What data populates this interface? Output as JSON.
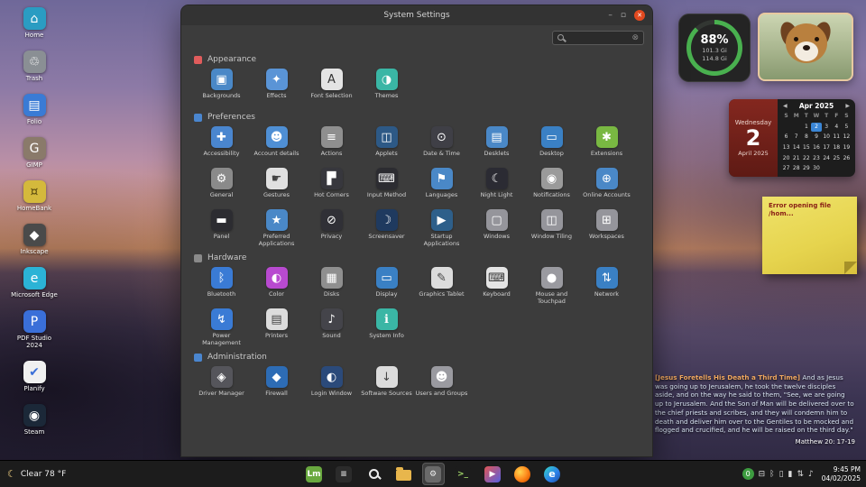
{
  "window": {
    "title": "System Settings",
    "controls": {
      "minimize": "–",
      "maximize": "▫",
      "close": "✕"
    },
    "search": {
      "value": "",
      "placeholder": "",
      "clear_glyph": "⊗"
    },
    "sections": [
      {
        "name": "Appearance",
        "color": "#e05c5c",
        "items": [
          {
            "label": "Backgrounds",
            "bg": "#4a88c7",
            "glyph": "▣"
          },
          {
            "label": "Effects",
            "bg": "#5a94d6",
            "glyph": "✦"
          },
          {
            "label": "Font Selection",
            "bg": "#e4e4e4",
            "fg": "#333333",
            "glyph": "A"
          },
          {
            "label": "Themes",
            "bg": "#3ab6a5",
            "glyph": "◑"
          }
        ]
      },
      {
        "name": "Preferences",
        "color": "#4a86cf",
        "items": [
          {
            "label": "Accessibility",
            "bg": "#4a86cf",
            "glyph": "✚"
          },
          {
            "label": "Account details",
            "bg": "#4f8fd4",
            "glyph": "☻"
          },
          {
            "label": "Actions",
            "bg": "#8f8f8f",
            "glyph": "≡"
          },
          {
            "label": "Applets",
            "bg": "#2d5986",
            "glyph": "◫"
          },
          {
            "label": "Date & Time",
            "bg": "#3f3f46",
            "glyph": "⊙"
          },
          {
            "label": "Desklets",
            "bg": "#4a88c7",
            "glyph": "▤"
          },
          {
            "label": "Desktop",
            "bg": "#3a80c4",
            "glyph": "▭"
          },
          {
            "label": "Extensions",
            "bg": "#79b842",
            "glyph": "✱"
          },
          {
            "label": "General",
            "bg": "#8a8a8a",
            "glyph": "⚙"
          },
          {
            "label": "Gestures",
            "bg": "#e0e0e0",
            "fg": "#444444",
            "glyph": "☛"
          },
          {
            "label": "Hot Corners",
            "bg": "#37373d",
            "glyph": "▛"
          },
          {
            "label": "Input Method",
            "bg": "#2c2c31",
            "glyph": "⌨"
          },
          {
            "label": "Languages",
            "bg": "#4a88c7",
            "glyph": "⚑"
          },
          {
            "label": "Night Light",
            "bg": "#2b2b33",
            "glyph": "☾"
          },
          {
            "label": "Notifications",
            "bg": "#9a9a9a",
            "glyph": "◉"
          },
          {
            "label": "Online Accounts",
            "bg": "#4a88c7",
            "glyph": "⊕"
          },
          {
            "label": "Panel",
            "bg": "#2c2c31",
            "glyph": "▬"
          },
          {
            "label": "Preferred Applications",
            "bg": "#4a88c7",
            "glyph": "★"
          },
          {
            "label": "Privacy",
            "bg": "#303036",
            "glyph": "⊘"
          },
          {
            "label": "Screensaver",
            "bg": "#1f3a5f",
            "glyph": "☽"
          },
          {
            "label": "Startup Applications",
            "bg": "#2e5f8a",
            "glyph": "▶"
          },
          {
            "label": "Windows",
            "bg": "#95959b",
            "glyph": "▢"
          },
          {
            "label": "Window Tiling",
            "bg": "#95959b",
            "glyph": "◫"
          },
          {
            "label": "Workspaces",
            "bg": "#95959b",
            "glyph": "⊞"
          }
        ]
      },
      {
        "name": "Hardware",
        "color": "#8a8a8a",
        "items": [
          {
            "label": "Bluetooth",
            "bg": "#3a7bd5",
            "glyph": "ᛒ"
          },
          {
            "label": "Color",
            "bg": "#b84ad0",
            "glyph": "◐"
          },
          {
            "label": "Disks",
            "bg": "#8f8f8f",
            "glyph": "▦"
          },
          {
            "label": "Display",
            "bg": "#3a80c4",
            "glyph": "▭"
          },
          {
            "label": "Graphics Tablet",
            "bg": "#dcdcdc",
            "fg": "#444444",
            "glyph": "✎"
          },
          {
            "label": "Keyboard",
            "bg": "#e4e4e4",
            "fg": "#333333",
            "glyph": "⌨"
          },
          {
            "label": "Mouse and Touchpad",
            "bg": "#9a9aa0",
            "glyph": "●"
          },
          {
            "label": "Network",
            "bg": "#3a80c4",
            "glyph": "⇅"
          },
          {
            "label": "Power Management",
            "bg": "#3a7bd5",
            "glyph": "↯"
          },
          {
            "label": "Printers",
            "bg": "#dcdcdc",
            "fg": "#444444",
            "glyph": "▤"
          },
          {
            "label": "Sound",
            "bg": "#44444a",
            "glyph": "♪"
          },
          {
            "label": "System Info",
            "bg": "#3ab6a5",
            "glyph": "ℹ"
          }
        ]
      },
      {
        "name": "Administration",
        "color": "#4a86cf",
        "items": [
          {
            "label": "Driver Manager",
            "bg": "#55555b",
            "glyph": "◈"
          },
          {
            "label": "Firewall",
            "bg": "#2d6cb5",
            "glyph": "◆"
          },
          {
            "label": "Login Window",
            "bg": "#2b4a7a",
            "glyph": "◐"
          },
          {
            "label": "Software Sources",
            "bg": "#dcdcdc",
            "fg": "#444444",
            "glyph": "↓"
          },
          {
            "label": "Users and Groups",
            "bg": "#9a9aa0",
            "glyph": "☻"
          }
        ]
      }
    ]
  },
  "desktop": {
    "icons": [
      {
        "label": "Home",
        "bg": "#2a9cc2",
        "glyph": "⌂"
      },
      {
        "label": "Trash",
        "bg": "#8a8f94",
        "glyph": "♲"
      },
      {
        "label": "Folio",
        "bg": "#3a7bd5",
        "glyph": "▤"
      },
      {
        "label": "GIMP",
        "bg": "#8a7a6a",
        "glyph": "G"
      },
      {
        "label": "HomeBank",
        "bg": "#d4b93c",
        "fg": "#5a4a10",
        "glyph": "¤"
      },
      {
        "label": "Inkscape",
        "bg": "#4a4a4a",
        "glyph": "◆"
      },
      {
        "label": "Microsoft Edge",
        "bg": "#2bb3d6",
        "glyph": "e"
      },
      {
        "label": "PDF Studio 2024",
        "bg": "#3a6fd8",
        "glyph": "P"
      },
      {
        "label": "Planify",
        "bg": "#f0f0f0",
        "fg": "#3a6fd8",
        "glyph": "✔"
      },
      {
        "label": "Steam",
        "bg": "#1b2838",
        "glyph": "◉"
      }
    ]
  },
  "widgets": {
    "disk": {
      "percent": "88%",
      "used": "101.3 Gi",
      "total": "114.8 Gi"
    },
    "calendar": {
      "weekday": "Wednesday",
      "day": "2",
      "month_year": "April 2025",
      "header": "Apr 2025",
      "prev_glyph": "◀",
      "next_glyph": "▶",
      "dow": [
        "S",
        "M",
        "T",
        "W",
        "T",
        "F",
        "S"
      ],
      "weeks": [
        [
          "",
          "",
          "1",
          "2",
          "3",
          "4",
          "5"
        ],
        [
          "6",
          "7",
          "8",
          "9",
          "10",
          "11",
          "12"
        ],
        [
          "13",
          "14",
          "15",
          "16",
          "17",
          "18",
          "19"
        ],
        [
          "20",
          "21",
          "22",
          "23",
          "24",
          "25",
          "26"
        ],
        [
          "27",
          "28",
          "29",
          "30",
          "",
          "",
          ""
        ]
      ],
      "selected": "2"
    },
    "note": {
      "text": "Error opening file /hom..."
    },
    "verse": {
      "title": "[Jesus Foretells His Death a Third Time]",
      "text": " And as Jesus was going up to Jerusalem, he took the twelve disciples aside, and on the way he said to them, \"See, we are going up to Jerusalem. And the Son of Man will be delivered over to the chief priests and scribes, and they will condemn him to death and deliver him over to the Gentiles to be mocked and flogged and crucified, and he will be raised on the third day.\"",
      "reference": "Matthew 20: 17-19"
    }
  },
  "taskbar": {
    "weather": {
      "icon_glyph": "☾",
      "label": "Clear 78 °F"
    },
    "center": [
      {
        "name": "mint-menu-icon",
        "bg": "#69a83f",
        "glyph": "Lm",
        "fg": "#ffffff"
      },
      {
        "name": "text-editor-icon",
        "bg": "#2b2b2b",
        "glyph": "≡",
        "fg": "#dddddd"
      },
      {
        "name": "search-icon",
        "shape": "mag"
      },
      {
        "name": "files-icon",
        "shape": "folder"
      },
      {
        "name": "system-settings-icon",
        "bg": "#6a6a6a",
        "glyph": "⚙",
        "fg": "#eeeeee",
        "active": true
      },
      {
        "name": "terminal-icon",
        "bg": "#1c1c1c",
        "glyph": ">_",
        "fg": "#9fd468"
      },
      {
        "name": "media-app-icon",
        "bg": "linear-gradient(135deg,#e25555,#5560e2)",
        "glyph": "▶",
        "fg": "#ffffff"
      },
      {
        "name": "firefox-icon",
        "shape": "ffx"
      },
      {
        "name": "edge-icon",
        "shape": "edge",
        "glyph": "e"
      }
    ],
    "tray": [
      {
        "name": "updates-badge",
        "glyph": "0",
        "bg": "#3d9c40"
      },
      {
        "name": "usb-icon",
        "glyph": "⊟"
      },
      {
        "name": "bluetooth-icon",
        "glyph": "ᛒ"
      },
      {
        "name": "phone-icon",
        "glyph": "▯"
      },
      {
        "name": "battery-icon",
        "glyph": "▮"
      },
      {
        "name": "network-icon",
        "glyph": "⇅"
      },
      {
        "name": "volume-icon",
        "glyph": "♪"
      }
    ],
    "clock": {
      "time": "9:45 PM",
      "date": "04/02/2025"
    }
  }
}
